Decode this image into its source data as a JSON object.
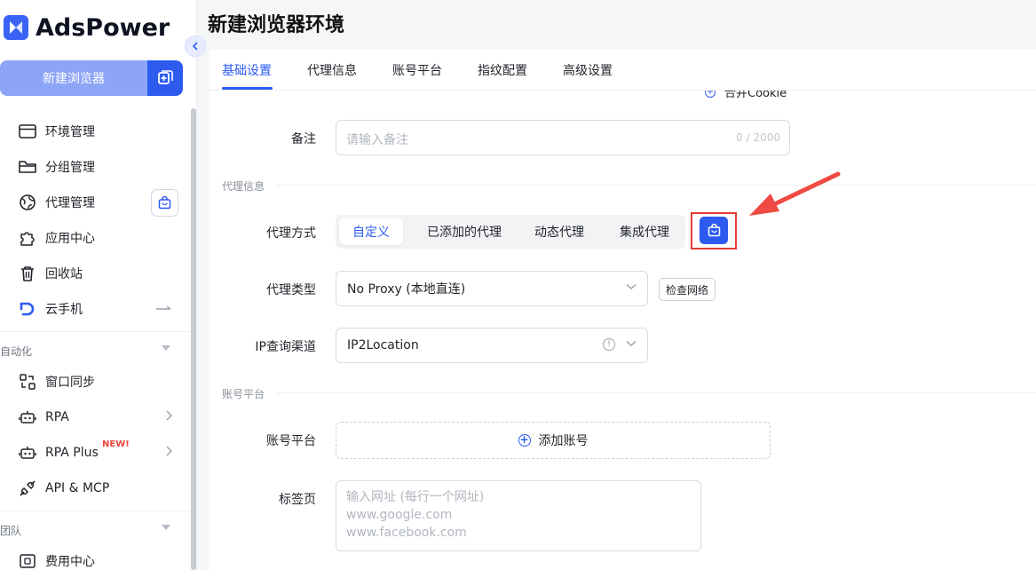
{
  "app": {
    "name": "AdsPower"
  },
  "colors": {
    "brand": "#2d5bf0",
    "brand_light": "#8da5f7",
    "highlight": "#e23c36",
    "badge_red": "#f0463c"
  },
  "sidebar": {
    "new_browser_label": "新建浏览器",
    "items": [
      {
        "label": "环境管理",
        "icon": "browser-window-icon"
      },
      {
        "label": "分组管理",
        "icon": "folder-icon"
      },
      {
        "label": "代理管理",
        "icon": "proxy-globe-icon"
      },
      {
        "label": "应用中心",
        "icon": "puzzle-icon"
      },
      {
        "label": "回收站",
        "icon": "trash-icon"
      },
      {
        "label": "云手机",
        "icon": "cloud-phone-icon"
      }
    ],
    "automation_title": "自动化",
    "automation_items": [
      {
        "label": "窗口同步",
        "icon": "window-sync-icon"
      },
      {
        "label": "RPA",
        "icon": "robot-icon"
      },
      {
        "label": "RPA Plus",
        "icon": "robot-plus-icon",
        "badge": "NEW!"
      },
      {
        "label": "API & MCP",
        "icon": "api-plug-icon"
      }
    ],
    "team_title": "团队",
    "team_items": [
      {
        "label": "费用中心",
        "icon": "billing-icon"
      }
    ]
  },
  "main": {
    "title": "新建浏览器环境",
    "tabs": [
      "基础设置",
      "代理信息",
      "账号平台",
      "指纹配置",
      "高级设置"
    ],
    "active_tab": 0,
    "cookie_partial": "合并Cookie",
    "remark": {
      "label": "备注",
      "placeholder": "请输入备注",
      "counter": "0 / 2000"
    },
    "proxy_section": "代理信息",
    "proxy_method": {
      "label": "代理方式",
      "options": [
        "自定义",
        "已添加的代理",
        "动态代理",
        "集成代理"
      ],
      "selected": 0
    },
    "proxy_type": {
      "label": "代理类型",
      "value": "No Proxy (本地直连)",
      "check_button": "检查网络"
    },
    "ip_channel": {
      "label": "IP查询渠道",
      "value": "IP2Location"
    },
    "account_section": "账号平台",
    "account_platform": {
      "label": "账号平台",
      "add_label": "添加账号"
    },
    "tabs_field": {
      "label": "标签页",
      "placeholder_lines": [
        "输入网址 (每行一个网址)",
        "www.google.com",
        "www.facebook.com"
      ]
    }
  }
}
